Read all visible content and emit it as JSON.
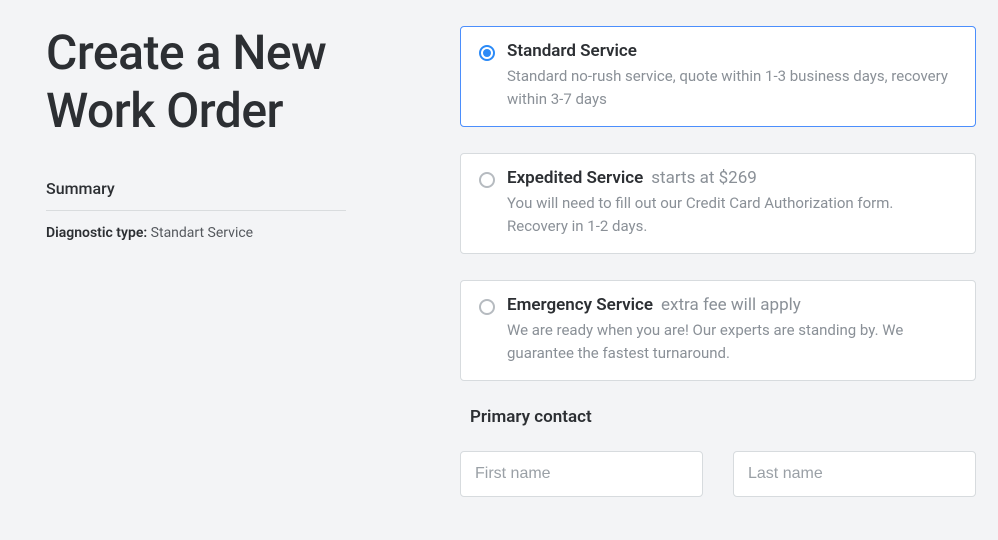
{
  "title": "Create a New Work Order",
  "summary": {
    "heading": "Summary",
    "diag_label": "Diagnostic type:",
    "diag_value": "Standart Service"
  },
  "options": [
    {
      "title": "Standard Service",
      "suffix": "",
      "desc": "Standard no-rush service, quote within 1-3 business days, recovery within 3-7 days",
      "selected": true
    },
    {
      "title": "Expedited Service",
      "suffix": "starts at $269",
      "desc": "You will need to fill out our Credit Card Authorization form. Recovery in 1-2 days.",
      "selected": false
    },
    {
      "title": "Emergency Service",
      "suffix": "extra fee will apply",
      "desc": "We are ready when you are! Our experts are standing by. We guarantee the fastest turnaround.",
      "selected": false
    }
  ],
  "contact": {
    "heading": "Primary contact",
    "first_placeholder": "First name",
    "last_placeholder": "Last name",
    "first_value": "",
    "last_value": ""
  }
}
